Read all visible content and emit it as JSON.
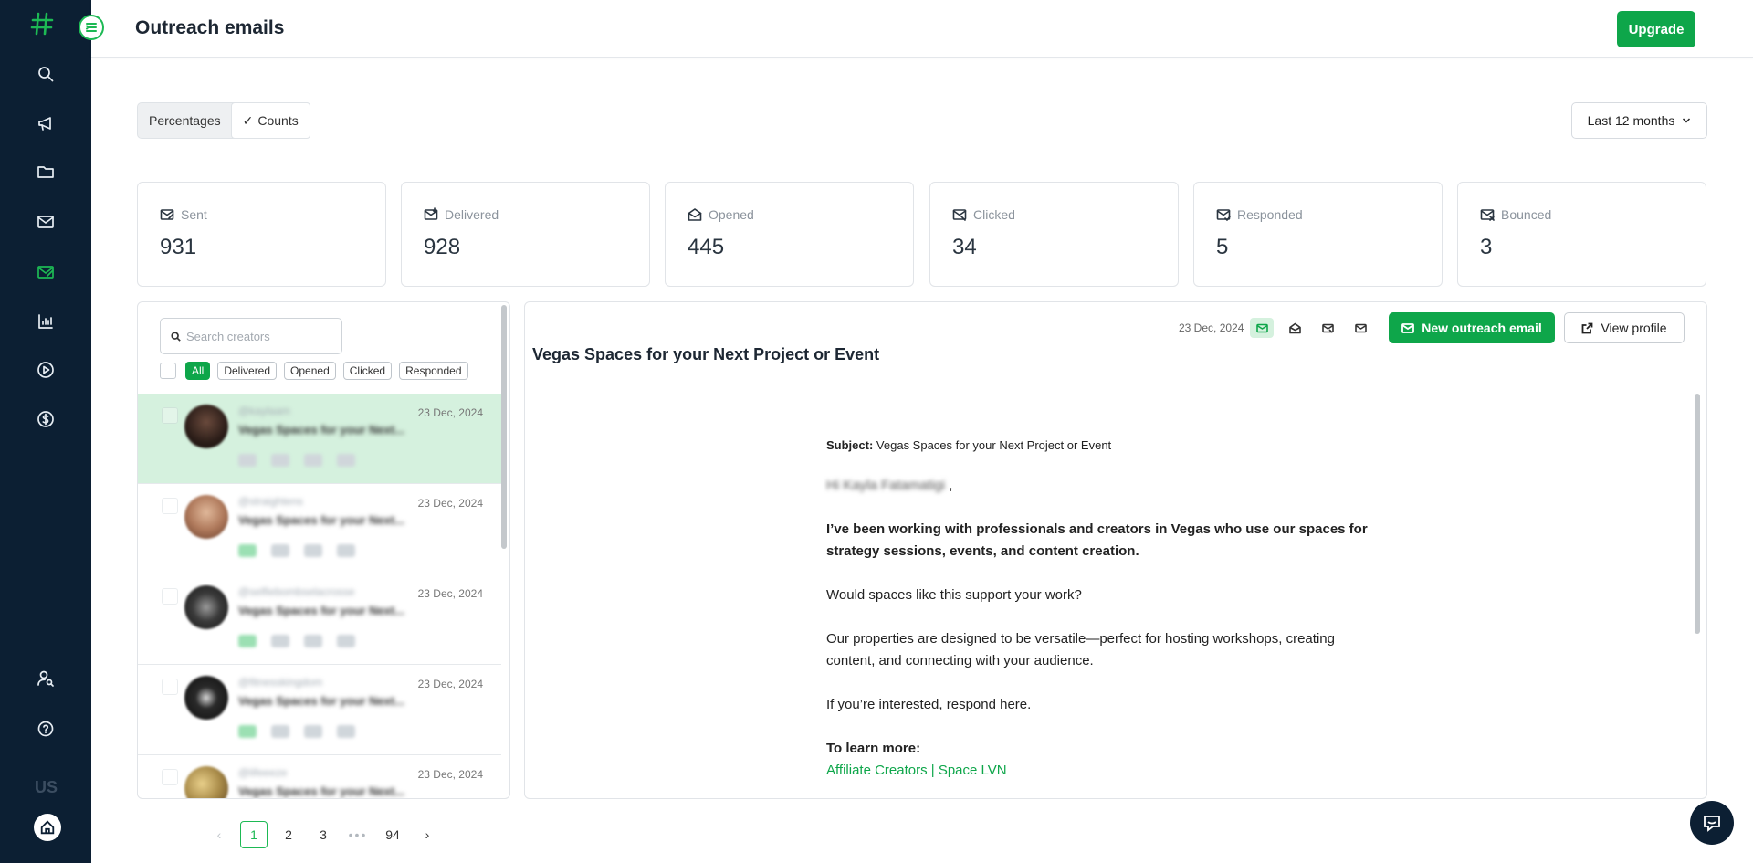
{
  "header": {
    "title": "Outreach emails",
    "upgrade_label": "Upgrade"
  },
  "toggle": {
    "percentages": "Percentages",
    "counts": "Counts",
    "selected": "Counts"
  },
  "range": {
    "label": "Last 12 months"
  },
  "stats": [
    {
      "label": "Sent",
      "value": "931"
    },
    {
      "label": "Delivered",
      "value": "928"
    },
    {
      "label": "Opened",
      "value": "445"
    },
    {
      "label": "Clicked",
      "value": "34"
    },
    {
      "label": "Responded",
      "value": "5"
    },
    {
      "label": "Bounced",
      "value": "3"
    }
  ],
  "list": {
    "search_placeholder": "Search creators",
    "filters": [
      "All",
      "Delivered",
      "Opened",
      "Clicked",
      "Responded"
    ],
    "active_filter": "All",
    "rows": [
      {
        "handle": "@kaylaam",
        "subject": "Vegas Spaces for your Next...",
        "date": "23 Dec, 2024",
        "avatar_color": "#2b1d18"
      },
      {
        "handle": "@straightens",
        "subject": "Vegas Spaces for your Next...",
        "date": "23 Dec, 2024",
        "avatar_color": "#b07a5c"
      },
      {
        "handle": "@selfiebombselacrosse",
        "subject": "Vegas Spaces for your Next...",
        "date": "23 Dec, 2024",
        "avatar_color": "#2f2f2f"
      },
      {
        "handle": "@fitnesskingdom",
        "subject": "Vegas Spaces for your Next...",
        "date": "23 Dec, 2024",
        "avatar_color": "#1a1a1a"
      },
      {
        "handle": "@lifeeeze",
        "subject": "Vegas Spaces for your Next...",
        "date": "23 Dec, 2024",
        "avatar_color": "#a88a48"
      }
    ]
  },
  "pagination": {
    "pages": [
      "1",
      "2",
      "3",
      "•••",
      "94"
    ],
    "current": "1",
    "prev": "‹",
    "next": "›"
  },
  "detail": {
    "date": "23 Dec, 2024",
    "title": "Vegas Spaces for your Next Project or Event",
    "new_button": "New outreach email",
    "profile_button": "View profile",
    "email": {
      "subject_label": "Subject:",
      "subject": "Vegas Spaces for your Next Project or Event",
      "greeting": "Hi Kayla Fatamatigi",
      "p1": "I’ve been working with professionals and creators in Vegas who use our spaces for strategy sessions, events, and content creation.",
      "p2": "Would spaces like this support your work?",
      "p3": "Our properties are designed to be versatile—perfect for hosting workshops, creating content, and connecting with your audience.",
      "p4": "If you’re interested, respond here.",
      "learn_more": "To learn more:",
      "link": "Affiliate Creators | Space LVN"
    }
  },
  "sidebar": {
    "footer_text": "US"
  },
  "colors": {
    "brand_green": "#0ea64a",
    "sidebar": "#0c1f33"
  }
}
